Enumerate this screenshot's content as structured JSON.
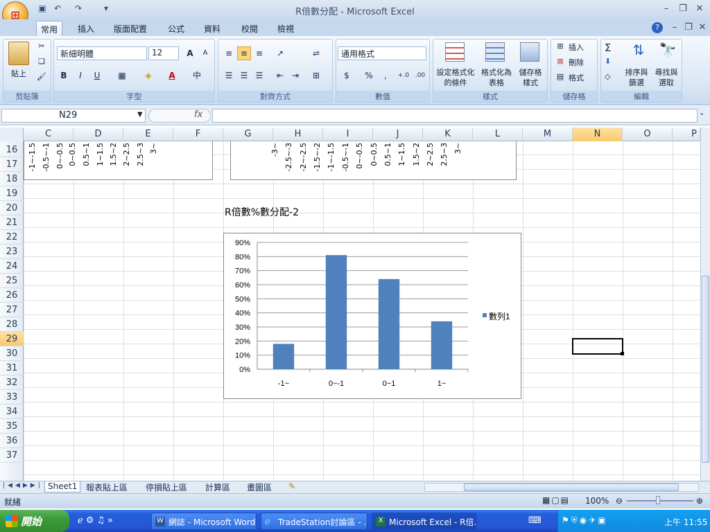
{
  "window": {
    "title": "R倍數分配 - Microsoft Excel"
  },
  "ribbon_tabs": [
    "常用",
    "插入",
    "版面配置",
    "公式",
    "資料",
    "校閱",
    "檢視"
  ],
  "ribbon": {
    "paste": "貼上",
    "clipboard": "剪貼簿",
    "font_name": "新細明體",
    "font_size": "12",
    "font_group": "字型",
    "align_group": "對齊方式",
    "number_format": "通用格式",
    "number_group": "數值",
    "cond_format_1": "設定格式化",
    "cond_format_2": "的條件",
    "format_table_1": "格式化為",
    "format_table_2": "表格",
    "cell_styles_1": "儲存格",
    "cell_styles_2": "樣式",
    "styles_group": "樣式",
    "insert": "插入",
    "delete": "刪除",
    "format": "格式",
    "cells_group": "儲存格",
    "sort_1": "排序與",
    "sort_2": "篩選",
    "find_1": "尋找與",
    "find_2": "選取",
    "editing_group": "編輯"
  },
  "name_box": "N29",
  "columns": [
    "C",
    "D",
    "E",
    "F",
    "G",
    "H",
    "I",
    "J",
    "K",
    "L",
    "M",
    "N",
    "O",
    "P"
  ],
  "rows": [
    "16",
    "17",
    "18",
    "19",
    "20",
    "21",
    "22",
    "23",
    "24",
    "25",
    "26",
    "27",
    "28",
    "29",
    "30",
    "31",
    "32",
    "33",
    "34",
    "35",
    "36",
    "37"
  ],
  "upper_chart_left_labels": [
    "-1~-1.5",
    "-0.5~-1",
    "0~-0.5",
    "0~0.5",
    "0.5~1",
    "1~1.5",
    "1.5~2",
    "2~2.5",
    "2.5~3",
    "3~"
  ],
  "upper_chart_right_labels": [
    "-3~",
    "-2.5~-3",
    "-2~-2.5",
    "-1.5~-2",
    "-1~-1.5",
    "-0.5~-1",
    "0~-0.5",
    "0~0.5",
    "0.5~1",
    "1~1.5",
    "1.5~2",
    "2~2.5",
    "2.5~3",
    "3~"
  ],
  "chart_caption": "R倍數%數分配-2",
  "chart_data": {
    "type": "bar",
    "categories": [
      "-1~",
      "0~-1",
      "0~1",
      "1~"
    ],
    "series": [
      {
        "name": "數列1",
        "values": [
          0.18,
          0.81,
          0.64,
          0.34
        ]
      }
    ],
    "ylim": [
      0,
      0.9
    ],
    "yticks": [
      "0%",
      "10%",
      "20%",
      "30%",
      "40%",
      "50%",
      "60%",
      "70%",
      "80%",
      "90%"
    ],
    "grid": true,
    "legend": "right",
    "color": "#4f81bd"
  },
  "sheet_tabs": [
    "Sheet1",
    "報表貼上區",
    "停損貼上區",
    "計算區",
    "畫圖區"
  ],
  "status": {
    "ready": "就緒",
    "zoom": "100%"
  },
  "taskbar": {
    "start": "開始",
    "tasks": [
      "網誌 - Microsoft Word",
      "TradeStation討論區 - ...",
      "Microsoft Excel - R倍..."
    ],
    "clock": "上午 11:55"
  }
}
